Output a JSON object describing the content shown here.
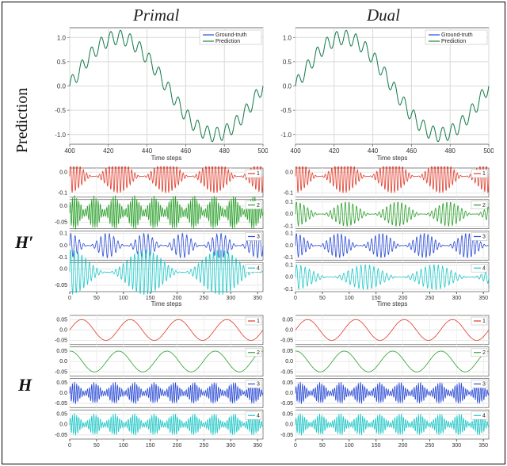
{
  "columns": {
    "primal": "Primal",
    "dual": "Dual"
  },
  "side": {
    "prediction": "Prediction",
    "Hp": "H′",
    "H": "H"
  },
  "axisLabel": {
    "time": "Time steps"
  },
  "legend": {
    "gt": "Ground-truth",
    "pred": "Prediction"
  },
  "colors": {
    "gt": "#2b4bd6",
    "pred": "#1a8a3b",
    "h1": "#e03a2a",
    "h2": "#2ca02c",
    "h3": "#2b4bd6",
    "h4": "#1fc7c7",
    "axis": "#555"
  },
  "chart_data": [
    {
      "id": "primal_pred",
      "type": "line",
      "title": "",
      "xlabel": "Time steps",
      "ylabel": "",
      "xlim": [
        400,
        500
      ],
      "ylim": [
        -1.2,
        1.2
      ],
      "xticks": [
        400,
        420,
        440,
        460,
        480,
        500
      ],
      "yticks": [
        -1.0,
        -0.5,
        0.0,
        0.5,
        1.0
      ],
      "legend": [
        "Ground-truth",
        "Prediction"
      ],
      "series": [
        {
          "name": "Ground-truth",
          "color": "gt",
          "model": "sum_sines",
          "components": [
            {
              "A": 1.0,
              "T": 100,
              "phi": 0
            },
            {
              "A": 0.15,
              "T": 5,
              "phi": 0
            }
          ]
        },
        {
          "name": "Prediction",
          "color": "pred",
          "model": "sum_sines",
          "components": [
            {
              "A": 1.0,
              "T": 100,
              "phi": 0
            },
            {
              "A": 0.15,
              "T": 5,
              "phi": 0
            }
          ]
        }
      ]
    },
    {
      "id": "dual_pred",
      "type": "line",
      "title": "",
      "xlabel": "Time steps",
      "ylabel": "",
      "xlim": [
        400,
        500
      ],
      "ylim": [
        -1.2,
        1.2
      ],
      "xticks": [
        400,
        420,
        440,
        460,
        480,
        500
      ],
      "yticks": [
        -1.0,
        -0.5,
        0.0,
        0.5,
        1.0
      ],
      "legend": [
        "Ground-truth",
        "Prediction"
      ],
      "series": [
        {
          "name": "Ground-truth",
          "color": "gt",
          "model": "sum_sines",
          "components": [
            {
              "A": 1.0,
              "T": 100,
              "phi": 0
            },
            {
              "A": 0.15,
              "T": 5,
              "phi": 0
            }
          ]
        },
        {
          "name": "Prediction",
          "color": "pred",
          "model": "sum_sines",
          "components": [
            {
              "A": 1.0,
              "T": 100,
              "phi": 0
            },
            {
              "A": 0.15,
              "T": 5,
              "phi": 0
            }
          ]
        }
      ]
    },
    {
      "id": "primal_Hp",
      "type": "stacked-lines",
      "xlabel": "Time steps",
      "xlim": [
        0,
        360
      ],
      "xticks": [
        0,
        50,
        100,
        150,
        200,
        250,
        300,
        350
      ],
      "panels": [
        {
          "label": "1",
          "color": "h1",
          "yticks": [
            -0.1,
            0.0
          ],
          "model": "AM",
          "carrierT": 6,
          "envT": 90,
          "A": 0.08,
          "baseline": -0.02
        },
        {
          "label": "2",
          "color": "h2",
          "yticks": [
            -0.05,
            0.0
          ],
          "model": "noise_band",
          "A": 0.05,
          "baseline": -0.02
        },
        {
          "label": "3",
          "color": "h3",
          "yticks": [
            -0.1,
            0.0,
            0.1
          ],
          "model": "AM",
          "carrierT": 8,
          "envT": 70,
          "A": 0.1,
          "baseline": 0.0
        },
        {
          "label": "4",
          "color": "h4",
          "yticks": [
            -0.05,
            0.0
          ],
          "model": "AM",
          "carrierT": 7,
          "envT": 140,
          "A": 0.07,
          "baseline": -0.01
        }
      ]
    },
    {
      "id": "dual_Hp",
      "type": "stacked-lines",
      "xlabel": "Time steps",
      "xlim": [
        0,
        360
      ],
      "xticks": [
        0,
        50,
        100,
        150,
        200,
        250,
        300,
        350
      ],
      "panels": [
        {
          "label": "1",
          "color": "h1",
          "yticks": [
            -0.1,
            0.0
          ],
          "model": "AM",
          "carrierT": 6,
          "envT": 90,
          "A": 0.08,
          "baseline": -0.02
        },
        {
          "label": "2",
          "color": "h2",
          "yticks": [
            -0.1,
            0.0,
            0.1
          ],
          "model": "AM",
          "carrierT": 7,
          "envT": 95,
          "A": 0.1,
          "baseline": 0.0
        },
        {
          "label": "3",
          "color": "h3",
          "yticks": [
            -0.1,
            0.0,
            0.1
          ],
          "model": "AM",
          "carrierT": 7,
          "envT": 80,
          "A": 0.1,
          "baseline": 0.0
        },
        {
          "label": "4",
          "color": "h4",
          "yticks": [
            -0.1,
            0.0,
            0.1
          ],
          "model": "AM",
          "carrierT": 8,
          "envT": 130,
          "A": 0.1,
          "baseline": 0.0
        }
      ]
    },
    {
      "id": "primal_H",
      "type": "stacked-lines",
      "xlabel": "",
      "xlim": [
        0,
        360
      ],
      "xticks": [
        0,
        50,
        100,
        150,
        200,
        250,
        300,
        350
      ],
      "panels": [
        {
          "label": "1",
          "color": "h1",
          "yticks": [
            -0.05,
            0.0,
            0.05
          ],
          "model": "sine",
          "T": 90,
          "A": 0.05,
          "baseline": 0.0
        },
        {
          "label": "2",
          "color": "h2",
          "yticks": [
            -0.05,
            0.0,
            0.05
          ],
          "model": "sine",
          "T": 90,
          "A": 0.05,
          "baseline": 0.0,
          "phi": 1.5
        },
        {
          "label": "3",
          "color": "h3",
          "yticks": [
            -0.05,
            0.0,
            0.05
          ],
          "model": "noise_band",
          "A": 0.05,
          "baseline": 0.0
        },
        {
          "label": "4",
          "color": "h4",
          "yticks": [
            -0.05,
            0.0,
            0.05
          ],
          "model": "noise_band",
          "A": 0.05,
          "baseline": 0.0
        }
      ]
    },
    {
      "id": "dual_H",
      "type": "stacked-lines",
      "xlabel": "",
      "xlim": [
        0,
        360
      ],
      "xticks": [
        0,
        50,
        100,
        150,
        200,
        250,
        300,
        350
      ],
      "panels": [
        {
          "label": "1",
          "color": "h1",
          "yticks": [
            -0.05,
            0.0,
            0.05
          ],
          "model": "sine",
          "T": 90,
          "A": 0.05,
          "baseline": 0.0
        },
        {
          "label": "2",
          "color": "h2",
          "yticks": [
            -0.05,
            0.0,
            0.05
          ],
          "model": "sine",
          "T": 90,
          "A": 0.05,
          "baseline": 0.0,
          "phi": 1.5
        },
        {
          "label": "3",
          "color": "h3",
          "yticks": [
            -0.05,
            0.0,
            0.05
          ],
          "model": "noise_band",
          "A": 0.05,
          "baseline": 0.0
        },
        {
          "label": "4",
          "color": "h4",
          "yticks": [
            -0.05,
            0.0,
            0.05
          ],
          "model": "noise_band",
          "A": 0.05,
          "baseline": 0.0
        }
      ]
    }
  ]
}
